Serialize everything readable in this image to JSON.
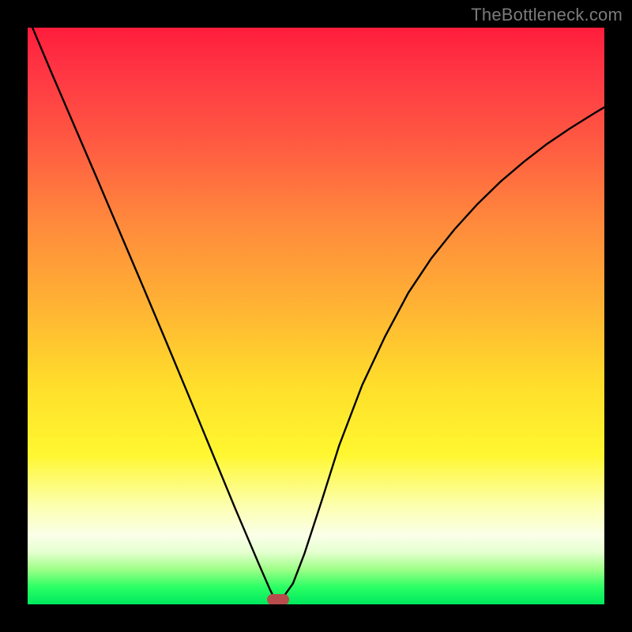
{
  "watermark": "TheBottleneck.com",
  "chart_data": {
    "type": "line",
    "title": "",
    "xlabel": "",
    "ylabel": "",
    "xlim": [
      0,
      1
    ],
    "ylim": [
      0,
      1
    ],
    "series": [
      {
        "name": "curve",
        "x": [
          0.0,
          0.04,
          0.08,
          0.12,
          0.16,
          0.2,
          0.24,
          0.28,
          0.32,
          0.36,
          0.4,
          0.42,
          0.43,
          0.44,
          0.46,
          0.48,
          0.51,
          0.54,
          0.58,
          0.62,
          0.66,
          0.7,
          0.74,
          0.78,
          0.82,
          0.86,
          0.9,
          0.94,
          0.98,
          1.0
        ],
        "y": [
          1.02,
          0.925,
          0.832,
          0.739,
          0.645,
          0.551,
          0.456,
          0.36,
          0.263,
          0.166,
          0.072,
          0.026,
          0.006,
          0.008,
          0.036,
          0.088,
          0.18,
          0.275,
          0.38,
          0.465,
          0.54,
          0.6,
          0.65,
          0.694,
          0.733,
          0.767,
          0.798,
          0.825,
          0.85,
          0.862
        ]
      }
    ],
    "marker": {
      "x": 0.434,
      "y": 0.0,
      "color": "#b84c4c"
    },
    "gradient_stops": [
      {
        "pos": 0.0,
        "color": "#ff1d3c"
      },
      {
        "pos": 0.2,
        "color": "#ff5a42"
      },
      {
        "pos": 0.48,
        "color": "#ffb234"
      },
      {
        "pos": 0.74,
        "color": "#fff730"
      },
      {
        "pos": 0.88,
        "color": "#faffe8"
      },
      {
        "pos": 1.0,
        "color": "#00e85e"
      }
    ]
  }
}
